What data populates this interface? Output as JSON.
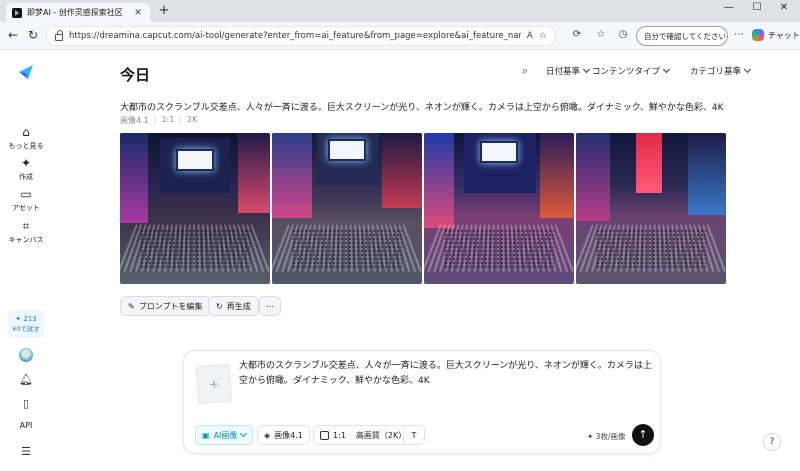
{
  "browser": {
    "tab_title": "即梦AI - 创作灵感探索社区",
    "tab_close": "✕",
    "new_tab": "+",
    "url": "https://dreamina.capcut.com/ai-tool/generate?enter_from=ai_feature&from_page=explore&ai_feature_name=image",
    "signin_label": "自分で確認してください",
    "copilot_label": "チャット",
    "win_min": "—",
    "win_max": "☐",
    "win_close": "✕"
  },
  "sidebar": {
    "items": [
      {
        "label": "もっと見る",
        "icon": "home-icon"
      },
      {
        "label": "作成",
        "icon": "sparkle-icon"
      },
      {
        "label": "アセット",
        "icon": "folder-icon"
      },
      {
        "label": "キャンバス",
        "icon": "canvas-icon"
      }
    ],
    "credits": "✦ 213",
    "credits_label": "¥0で試す",
    "api_label": "API"
  },
  "header": {
    "title": "今日",
    "filters": [
      "日付基準",
      "コンテンツタイプ",
      "カテゴリ基準"
    ]
  },
  "generation": {
    "prompt": "大都市のスクランブル交差点、人々が一斉に渡る。巨大スクリーンが光り、ネオンが輝く。カメラは上空から俯瞰。ダイナミック、鮮やかな色彩、4K",
    "meta": [
      "画像4.1",
      "1:1",
      "2K"
    ],
    "actions": [
      "プロンプトを編集",
      "再生成"
    ],
    "more": "⋯"
  },
  "composer": {
    "text": "大都市のスクランブル交差点、人々が一斉に渡る。巨大スクリーンが光り、ネオンが輝く。カメラは上空から俯瞰。ダイナミック、鮮やかな色彩、4K",
    "mode_label": "AI画像",
    "model_label": "画像4.1",
    "ratio_label": "1:1",
    "quality_label": "高画質（2K）",
    "quota_label": "✦ 3枚/画像",
    "send_symbol": "↑",
    "add_symbol": "+"
  },
  "help_symbol": "?"
}
